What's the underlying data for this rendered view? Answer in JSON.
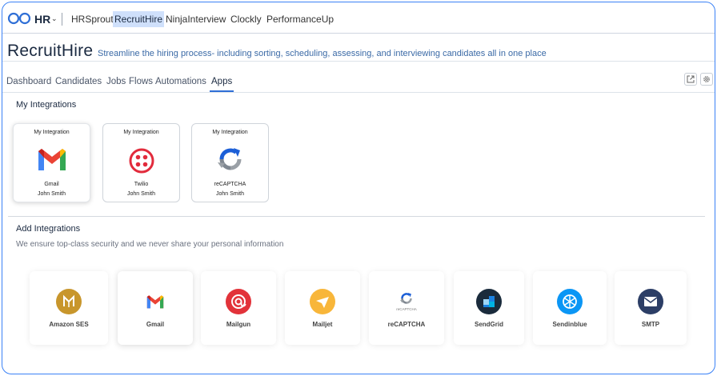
{
  "header": {
    "module_label": "HR",
    "nav": [
      "HRSprout",
      "RecruitHire",
      "NinjaInterview",
      "Clockly",
      "PerformanceUp"
    ],
    "active_nav": "RecruitHire"
  },
  "page": {
    "title": "RecruitHire",
    "subtitle": "Streamline the hiring process- including sorting, scheduling, assessing, and interviewing candidates all in one place"
  },
  "tabs": [
    "Dashboard",
    "Candidates",
    "Jobs",
    "Flows",
    "Automations",
    "Apps"
  ],
  "active_tab": "Apps",
  "my_integrations": {
    "title": "My Integrations",
    "cards": [
      {
        "header": "My Integration",
        "name": "Gmail",
        "user": "John Smith",
        "icon": "gmail-icon"
      },
      {
        "header": "My Integration",
        "name": "Twilio",
        "user": "John Smith",
        "icon": "twilio-icon"
      },
      {
        "header": "My Integration",
        "name": "reCAPTCHA",
        "user": "John Smith",
        "icon": "recaptcha-icon"
      }
    ]
  },
  "add_integrations": {
    "title": "Add Integrations",
    "description": "We ensure top-class security and we never share your personal information",
    "cards": [
      {
        "name": "Amazon SES",
        "icon": "amazon-ses-icon",
        "color": "#c8962c"
      },
      {
        "name": "Gmail",
        "icon": "gmail-icon",
        "color": "#ea4335"
      },
      {
        "name": "Mailgun",
        "icon": "mailgun-icon",
        "color": "#e2333a"
      },
      {
        "name": "Mailjet",
        "icon": "mailjet-icon",
        "color": "#f8b63a"
      },
      {
        "name": "reCAPTCHA",
        "icon": "recaptcha-icon",
        "color": "#1c5fd7",
        "icon_caption": "reCAPTCHA"
      },
      {
        "name": "SendGrid",
        "icon": "sendgrid-icon",
        "color": "#1a2b3c"
      },
      {
        "name": "Sendinblue",
        "icon": "sendinblue-icon",
        "color": "#0b96f5"
      },
      {
        "name": "SMTP",
        "icon": "smtp-icon",
        "color": "#2c3e66"
      }
    ]
  },
  "colors": {
    "accent": "#2f6fd6",
    "active_nav_bg": "#cfe0fb",
    "frame_border": "#3b82f6"
  }
}
